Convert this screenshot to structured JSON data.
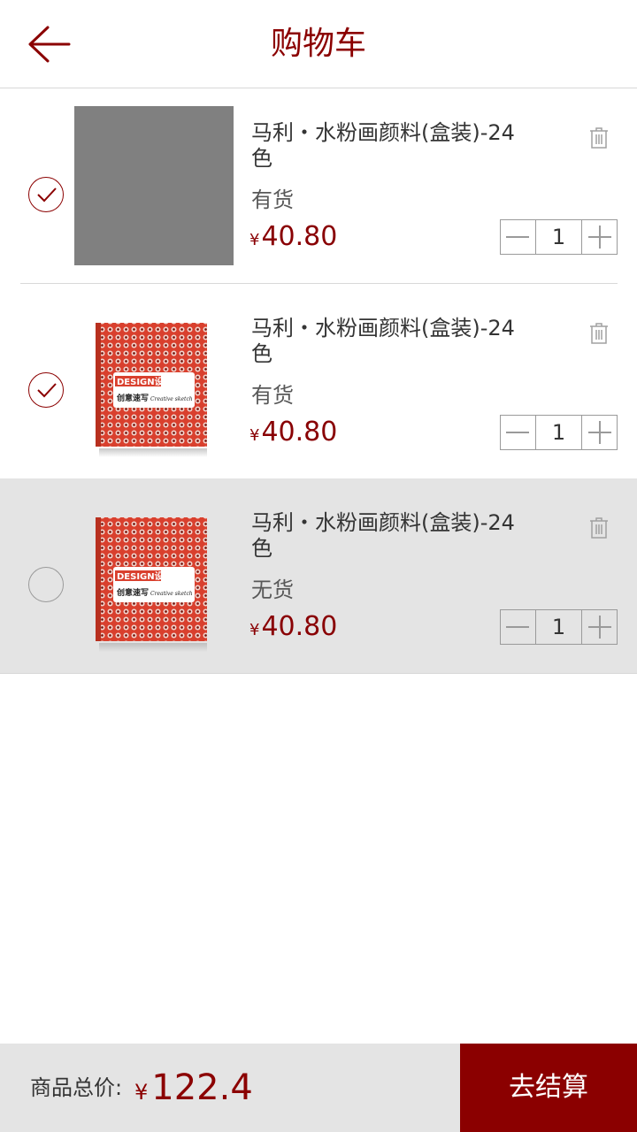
{
  "header": {
    "title": "购物车",
    "back_icon": "arrow-left-icon"
  },
  "colors": {
    "brand": "#8b0000",
    "price": "#890104",
    "text_main": "#343434",
    "text_sub": "#585858",
    "out_of_stock_bg": "#e4e4e4"
  },
  "items": [
    {
      "selected": true,
      "image": "gray-placeholder",
      "name": "马利・水粉画颜料(盒装)-24色",
      "stock": "有货",
      "currency": "¥",
      "price": "40.80",
      "quantity": "1"
    },
    {
      "selected": true,
      "image": "red-design-book-cover",
      "name": "马利・水粉画颜料(盒装)-24色",
      "stock": "有货",
      "currency": "¥",
      "price": "40.80",
      "quantity": "1"
    },
    {
      "selected": false,
      "image": "red-design-book-cover",
      "name": "马利・水粉画颜料(盒装)-24色",
      "stock": "无货",
      "currency": "¥",
      "price": "40.80",
      "quantity": "1"
    }
  ],
  "book_cover": {
    "title": "DESIGN设计",
    "subtitle": "创意速写",
    "english": "Creative sketch"
  },
  "footer": {
    "total_label": "商品总价:",
    "currency": "¥",
    "total": "122.4",
    "checkout_label": "去结算"
  }
}
